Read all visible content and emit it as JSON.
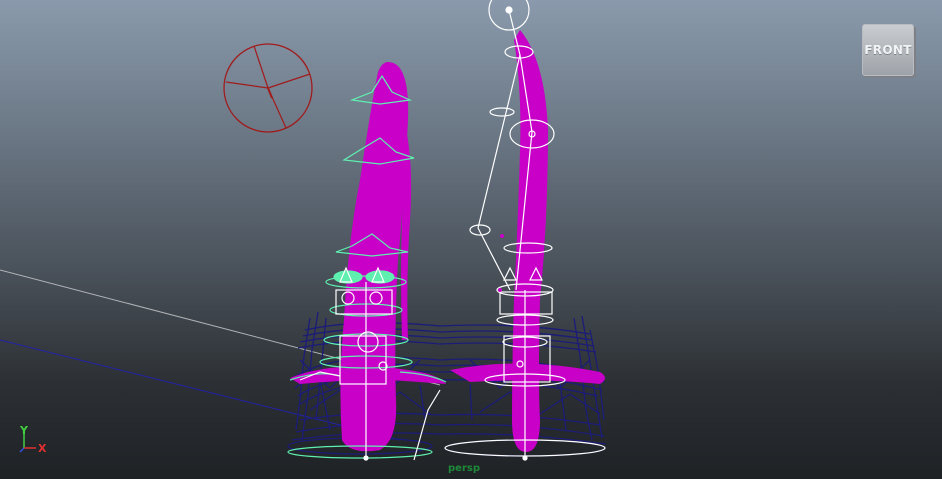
{
  "viewport": {
    "camera_name": "persp",
    "background_top": "#8a9aac",
    "background_bottom": "#1f2225"
  },
  "view_cube": {
    "face_label": "FRONT"
  },
  "axis_indicator": {
    "y_label": "Y",
    "x_label": "X"
  },
  "colors": {
    "mesh_magenta": "#c800c8",
    "wireframe_navy": "#1c1c78",
    "control_green": "#5ff0b0",
    "joint_white": "#ffffff",
    "light_red": "#a01c1c",
    "grid_line": "#b0b4b8"
  }
}
